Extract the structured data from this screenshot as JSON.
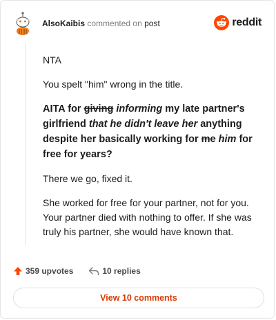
{
  "header": {
    "username": "AlsoKaibis",
    "action_text": "commented on",
    "post_link": "post",
    "brand": "reddit"
  },
  "comment": {
    "p1": "NTA",
    "p2": "You spelt \"him\" wrong in the title.",
    "title": {
      "prefix": "AITA for ",
      "struck1": "giving",
      "italic1": " informing",
      "mid1": " my late partner's girlfriend ",
      "italic2": "that he didn't leave her",
      "mid2": " anything despite her basically working for ",
      "struck2": "me",
      "italic3": " him",
      "suffix": " for free for years?"
    },
    "p4": "There we go, fixed it.",
    "p5": "She worked for free for your partner, not for you. Your partner died with nothing to offer. If she was truly his partner, she would have known that."
  },
  "footer": {
    "upvotes": "359 upvotes",
    "replies": "10 replies"
  },
  "view_button": "View 10 comments",
  "colors": {
    "brand_orange": "#ff4500",
    "link_red": "#d93a00"
  }
}
